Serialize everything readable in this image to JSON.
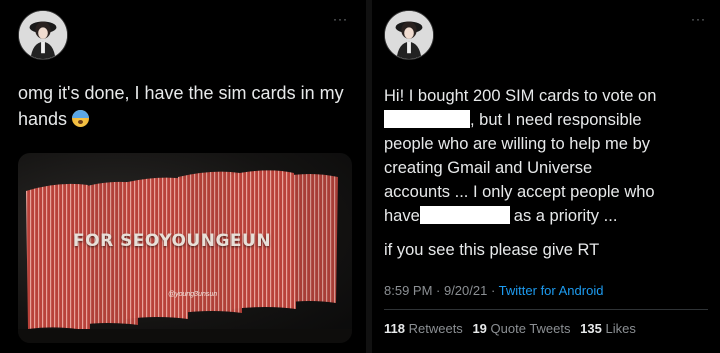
{
  "left_tweet": {
    "more": "···",
    "text": "omg it's done, I have the sim cards in my hands",
    "emoji": "fearful-face-emoji",
    "media": {
      "caption": "FOR SEOYOUNGEUN",
      "watermark": "@young3unsun"
    }
  },
  "right_tweet": {
    "more": "···",
    "lines": [
      "Hi! I bought 200 SIM cards to vote on",
      ", but I need responsible",
      "people who are willing to help me by",
      "creating Gmail and Universe",
      "accounts ... I only accept people who",
      "have",
      "as a priority ...",
      "if you see this please give RT"
    ],
    "time": "8:59 PM · 9/20/21 · ",
    "source": "Twitter for Android",
    "retweets_count": "118",
    "retweets_label": "Retweets",
    "quotes_count": "19",
    "quotes_label": "Quote Tweets",
    "likes_count": "135",
    "likes_label": "Likes"
  },
  "colors": {
    "background": "#000000",
    "text": "#e7e9ea",
    "muted": "#8b8f93",
    "link": "#1d9bf0",
    "sim_card_red": "#c2463f"
  }
}
